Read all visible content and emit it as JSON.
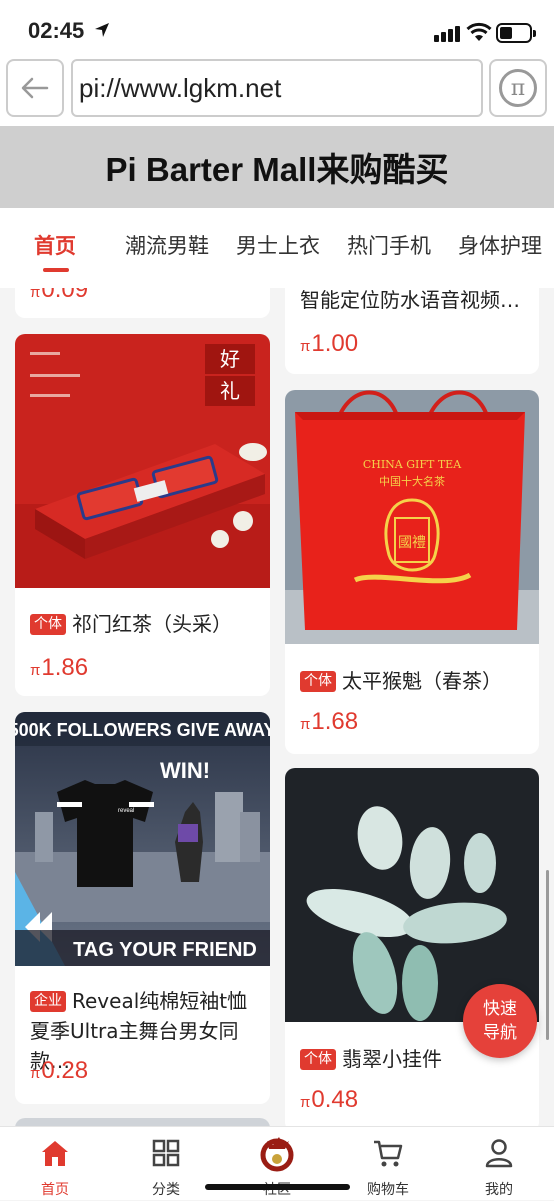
{
  "status_bar": {
    "time": "02:45"
  },
  "browser": {
    "url": "pi://www.lgkm.net"
  },
  "header": {
    "title": "Pi Barter Mall来购酷买"
  },
  "tabs": [
    {
      "label": "首页",
      "active": true
    },
    {
      "label": "潮流男鞋",
      "active": false
    },
    {
      "label": "男士上衣",
      "active": false
    },
    {
      "label": "热门手机",
      "active": false
    },
    {
      "label": "身体护理",
      "active": false
    }
  ],
  "products": {
    "left": [
      {
        "badge": "",
        "name": "",
        "price_symbol": "π",
        "price": "0.09"
      },
      {
        "badge": "个体",
        "name": "祁门红茶（头采）",
        "price_symbol": "π",
        "price": "1.86"
      },
      {
        "badge": "企业",
        "name": "Reveal纯棉短袖t恤夏季Ultra主舞台男女同款…",
        "price_symbol": "π",
        "price": "0.28",
        "image_text": {
          "top": "500K FOLLOWERS GIVE AWAY",
          "win": "WIN!",
          "bottom": "TAG YOUR FRIEND",
          "shirt": "reveal"
        }
      }
    ],
    "right": [
      {
        "badge": "",
        "name": "智能定位防水语音视频…",
        "price_symbol": "π",
        "price": "1.00"
      },
      {
        "badge": "个体",
        "name": "太平猴魁（春茶）",
        "price_symbol": "π",
        "price": "1.68",
        "image_text": {
          "line1": "CHINA GIFT TEA",
          "line2": "中国十大名茶",
          "seal": "國禮"
        }
      },
      {
        "badge": "个体",
        "name": "翡翠小挂件",
        "price_symbol": "π",
        "price": "0.48"
      }
    ],
    "tea_box_text": {
      "top": "好",
      "bottom": "礼"
    }
  },
  "fab": {
    "line1": "快速",
    "line2": "导航"
  },
  "bottom_nav": [
    {
      "label": "首页",
      "icon": "home-icon",
      "active": true
    },
    {
      "label": "分类",
      "icon": "grid-icon",
      "active": false
    },
    {
      "label": "社区",
      "icon": "dragon-logo-icon",
      "active": false
    },
    {
      "label": "购物车",
      "icon": "cart-icon",
      "active": false
    },
    {
      "label": "我的",
      "icon": "person-icon",
      "active": false
    }
  ],
  "colors": {
    "accent": "#e03a2f",
    "title_bg": "#cfcfcf"
  }
}
